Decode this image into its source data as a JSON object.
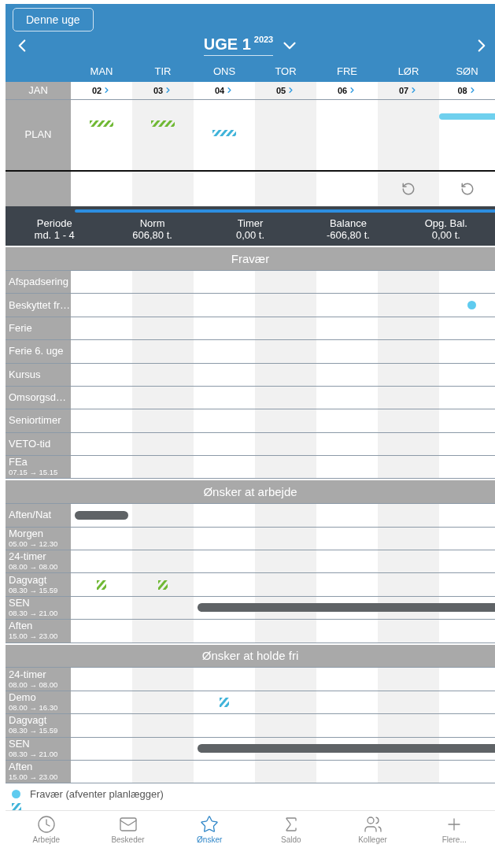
{
  "header": {
    "today_button": "Denne uge",
    "week_title": "UGE 1",
    "year": "2023",
    "days": [
      "MAN",
      "TIR",
      "ONS",
      "TOR",
      "FRE",
      "LØR",
      "SØN"
    ]
  },
  "month": "JAN",
  "dates": [
    "02",
    "03",
    "04",
    "05",
    "06",
    "07",
    "08"
  ],
  "plan": {
    "label": "PLAN",
    "cells": [
      {
        "kind": "hatch",
        "color": "#6fb833"
      },
      {
        "kind": "hatch",
        "color": "#6fb833"
      },
      {
        "kind": "hatch",
        "color": "#3fb3d9"
      },
      {
        "kind": "empty"
      },
      {
        "kind": "empty"
      },
      {
        "kind": "empty"
      },
      {
        "kind": "band",
        "color": "#6fd0ee"
      }
    ]
  },
  "actions": {
    "cells": [
      {
        "kind": "empty"
      },
      {
        "kind": "empty"
      },
      {
        "kind": "empty"
      },
      {
        "kind": "empty"
      },
      {
        "kind": "empty"
      },
      {
        "kind": "undo"
      },
      {
        "kind": "undo"
      }
    ]
  },
  "stats": [
    {
      "label": "Periode",
      "value": "md. 1 - 4"
    },
    {
      "label": "Norm",
      "value": "606,80 t."
    },
    {
      "label": "Timer",
      "value": "0,00 t."
    },
    {
      "label": "Balance",
      "value": "-606,80 t."
    },
    {
      "label": "Opg. Bal.",
      "value": "0,00 t."
    }
  ],
  "sections": [
    {
      "title": "Fravær",
      "rows": [
        {
          "name": "Afspadsering",
          "cells": []
        },
        {
          "name": "Beskyttet fr…",
          "cells": [
            {
              "kind": "empty"
            },
            {
              "kind": "empty"
            },
            {
              "kind": "empty"
            },
            {
              "kind": "empty"
            },
            {
              "kind": "empty"
            },
            {
              "kind": "empty"
            },
            {
              "kind": "dot",
              "color": "#5fcbef"
            }
          ]
        },
        {
          "name": "Ferie",
          "cells": []
        },
        {
          "name": "Ferie 6. uge",
          "cells": []
        },
        {
          "name": "Kursus",
          "cells": []
        },
        {
          "name": "Omsorgsd…",
          "cells": []
        },
        {
          "name": "Seniortimer",
          "cells": []
        },
        {
          "name": "VETO-tid",
          "cells": []
        },
        {
          "name": "FEa",
          "time": "07.15 → 15.15",
          "cells": []
        }
      ]
    },
    {
      "title": "Ønsker at arbejde",
      "rows": [
        {
          "name": "Aften/Nat",
          "cells": [
            {
              "kind": "bar"
            }
          ]
        },
        {
          "name": "Morgen",
          "time": "05.00 → 12.30",
          "cells": []
        },
        {
          "name": "24-timer",
          "time": "08.00 → 08.00",
          "cells": []
        },
        {
          "name": "Dagvagt",
          "time": "08.30 → 15.59",
          "cells": [
            {
              "kind": "stroke",
              "color": "#6fb833"
            },
            {
              "kind": "stroke",
              "color": "#6fb833"
            }
          ]
        },
        {
          "name": "SEN",
          "time": "08.30 → 21.00",
          "cells": [
            {
              "kind": "empty"
            },
            {
              "kind": "empty"
            },
            {
              "kind": "bar"
            },
            {
              "kind": "bar"
            },
            {
              "kind": "bar"
            },
            {
              "kind": "bar"
            },
            {
              "kind": "bar"
            }
          ]
        },
        {
          "name": "Aften",
          "time": "15.00 → 23.00",
          "cells": []
        }
      ]
    },
    {
      "title": "Ønsker at holde fri",
      "rows": [
        {
          "name": "24-timer",
          "time": "08.00 → 08.00",
          "cells": []
        },
        {
          "name": "Demo",
          "time": "08.00 → 16.30",
          "cells": [
            {
              "kind": "empty"
            },
            {
              "kind": "empty"
            },
            {
              "kind": "stroke",
              "color": "#3fb3d9"
            }
          ]
        },
        {
          "name": "Dagvagt",
          "time": "08.30 → 15.59",
          "cells": []
        },
        {
          "name": "SEN",
          "time": "08.30 → 21.00",
          "cells": [
            {
              "kind": "empty"
            },
            {
              "kind": "empty"
            },
            {
              "kind": "bar"
            },
            {
              "kind": "bar"
            },
            {
              "kind": "bar"
            },
            {
              "kind": "bar"
            },
            {
              "kind": "bar"
            }
          ]
        },
        {
          "name": "Aften",
          "time": "15.00 → 23.00",
          "cells": []
        }
      ]
    }
  ],
  "legend": [
    {
      "kind": "dot",
      "color": "#5fcbef",
      "text": "Fravær (afventer planlægger)"
    },
    {
      "kind": "stroke",
      "color": "#3fb3d9"
    }
  ],
  "nav": [
    {
      "label": "Arbejde",
      "selected": false
    },
    {
      "label": "Beskeder",
      "selected": false
    },
    {
      "label": "Ønsker",
      "selected": true
    },
    {
      "label": "Saldo",
      "selected": false
    },
    {
      "label": "Kolleger",
      "selected": false
    },
    {
      "label": "Flere...",
      "selected": false
    }
  ]
}
